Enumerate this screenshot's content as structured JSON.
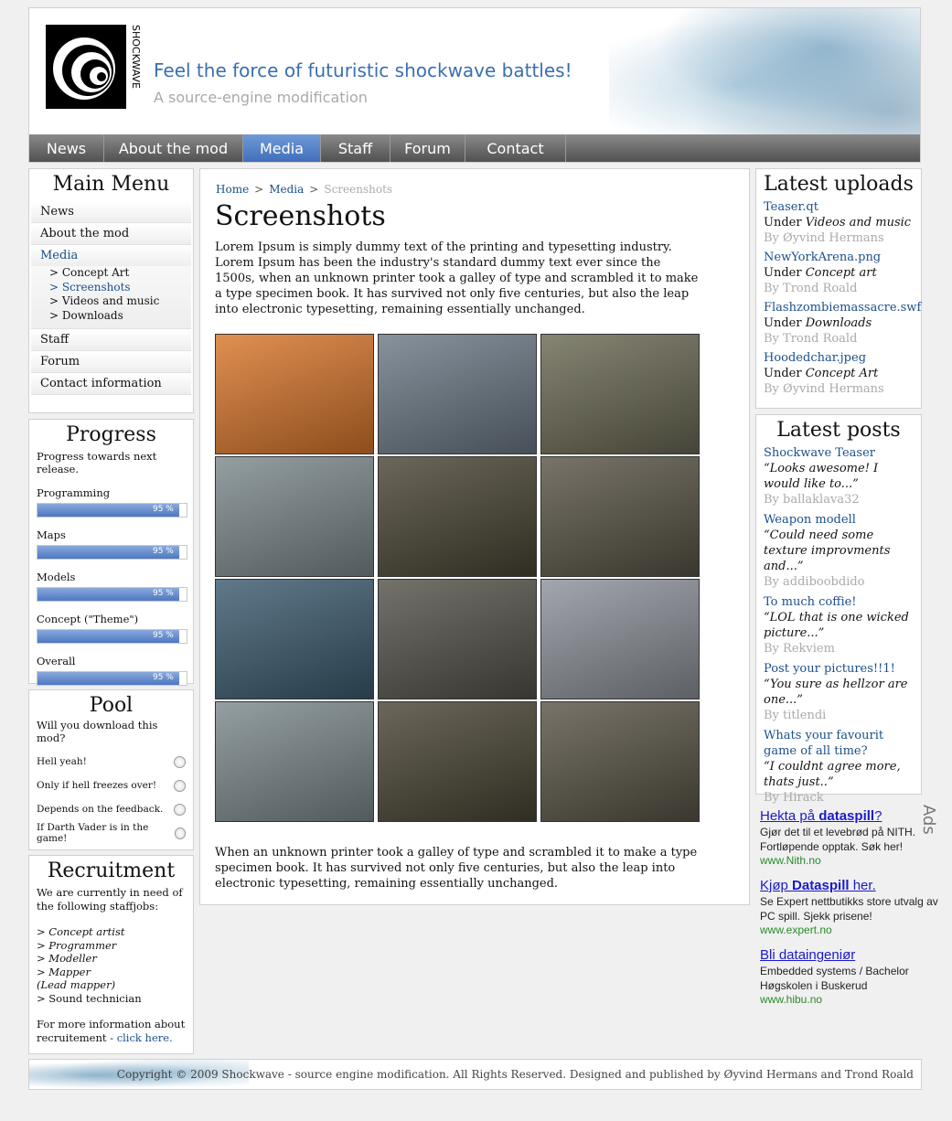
{
  "header": {
    "logo_text": "SHOCKWAVE",
    "tagline": "Feel the force of futuristic shockwave battles!",
    "subtagline": "A source-engine modification"
  },
  "nav": [
    "News",
    "About the mod",
    "Media",
    "Staff",
    "Forum",
    "Contact"
  ],
  "nav_active": "Media",
  "main_menu": {
    "title": "Main Menu",
    "items": [
      {
        "label": "News"
      },
      {
        "label": "About the mod"
      },
      {
        "label": "Media",
        "active": true,
        "sub": [
          {
            "label": "> Concept Art"
          },
          {
            "label": "> Screenshots",
            "active": true
          },
          {
            "label": "> Videos and music"
          },
          {
            "label": "> Downloads"
          }
        ]
      },
      {
        "label": "Staff"
      },
      {
        "label": "Forum"
      },
      {
        "label": "Contact information"
      }
    ]
  },
  "progress": {
    "title": "Progress",
    "intro": "Progress towards next release.",
    "items": [
      {
        "label": "Programming",
        "value": 95,
        "text": "95 %"
      },
      {
        "label": "Maps",
        "value": 95,
        "text": "95 %"
      },
      {
        "label": "Models",
        "value": 95,
        "text": "95 %"
      },
      {
        "label": "Concept (\"Theme\")",
        "value": 95,
        "text": "95 %"
      },
      {
        "label": "Overall",
        "value": 95,
        "text": "95 %"
      }
    ]
  },
  "pool": {
    "title": "Pool",
    "question": "Will you download this mod?",
    "options": [
      "Hell yeah!",
      "Only if hell freezes over!",
      "Depends on the feedback.",
      "If Darth Vader is in the game!"
    ]
  },
  "recruitment": {
    "title": "Recruitment",
    "intro": "We are currently in need of the following staffjobs:",
    "jobs": [
      "> Concept artist",
      "> Programmer",
      "> Modeller",
      "> Mapper",
      "(Lead mapper)",
      "> Sound technician"
    ],
    "more": "For more information about recruitement - ",
    "link": "click here."
  },
  "breadcrumb": {
    "home": "Home",
    "media": "Media",
    "current": "Screenshots",
    "sep": ">"
  },
  "page": {
    "title": "Screenshots",
    "intro": "Lorem Ipsum is simply dummy text of the printing and typesetting industry. Lorem Ipsum has been the industry's standard dummy text ever since the 1500s, when an unknown printer took a galley of type and scrambled it to make a type specimen book. It has survived not only five centuries, but also the leap into electronic typesetting, remaining essentially unchanged.",
    "outro": "When an unknown printer took a galley of type and scrambled it to make a type specimen book. It has survived not only five centuries, but also the leap into electronic typesetting, remaining essentially unchanged."
  },
  "screenshots": [
    {
      "bg": "#d9772c"
    },
    {
      "bg": "#6d7a86"
    },
    {
      "bg": "#6b6a55"
    },
    {
      "bg": "#7d8a8e"
    },
    {
      "bg": "#4a4535"
    },
    {
      "bg": "#5a5548"
    },
    {
      "bg": "#3d5c70"
    },
    {
      "bg": "#55534a"
    },
    {
      "bg": "#8e939b"
    },
    {
      "bg": "#7d8a8e"
    },
    {
      "bg": "#4a4535"
    },
    {
      "bg": "#5a5548"
    }
  ],
  "uploads": {
    "title": "Latest uploads",
    "items": [
      {
        "name": "Teaser.qt",
        "under": "Under ",
        "cat": "Videos and music",
        "by": "By Øyvind Hermans"
      },
      {
        "name": "NewYorkArena.png",
        "under": "Under ",
        "cat": "Concept art",
        "by": "By Trond Roald"
      },
      {
        "name": "Flashzombiemassacre.swf",
        "under": "Under ",
        "cat": "Downloads",
        "by": "By Trond Roald"
      },
      {
        "name": "Hoodedchar.jpeg",
        "under": "Under ",
        "cat": "Concept Art",
        "by": "By Øyvind Hermans"
      }
    ]
  },
  "posts": {
    "title": "Latest posts",
    "items": [
      {
        "title": "Shockwave Teaser",
        "quote": "“Looks awesome! I would like to...”",
        "by": "By ballaklava32"
      },
      {
        "title": "Weapon modell",
        "quote": "“Could need some texture improvments and...”",
        "by": "By addiboobdido"
      },
      {
        "title": "To much coffie!",
        "quote": "“LOL that is one wicked picture...”",
        "by": "By Rekviem"
      },
      {
        "title": "Post your pictures!!1!",
        "quote": "“You sure as hellzor are one...”",
        "by": "By titlendi"
      },
      {
        "title": "Whats your favourit game of all time?",
        "quote": "“I couldnt agree more, thats just..”",
        "by": "By Hirack"
      }
    ]
  },
  "ads": {
    "label": "Ads",
    "items": [
      {
        "pre": "Hekta på ",
        "bold": "dataspill",
        "post": "?",
        "desc": "Gjør det til et levebrød på NITH. Fortløpende opptak. Søk her!",
        "url": "www.Nith.no"
      },
      {
        "pre": "Kjøp ",
        "bold": "Dataspill",
        "post": " her.",
        "desc": "Se Expert nettbutikks store utvalg av PC spill. Sjekk prisene!",
        "url": "www.expert.no"
      },
      {
        "pre": "Bli dataingeniør",
        "bold": "",
        "post": "",
        "desc": "Embedded systems / Bachelor Høgskolen i Buskerud",
        "url": "www.hibu.no"
      }
    ]
  },
  "footer": "Copyright © 2009 Shockwave  - source engine modification. All Rights Reserved. Designed and published by Øyvind Hermans and Trond Roald"
}
